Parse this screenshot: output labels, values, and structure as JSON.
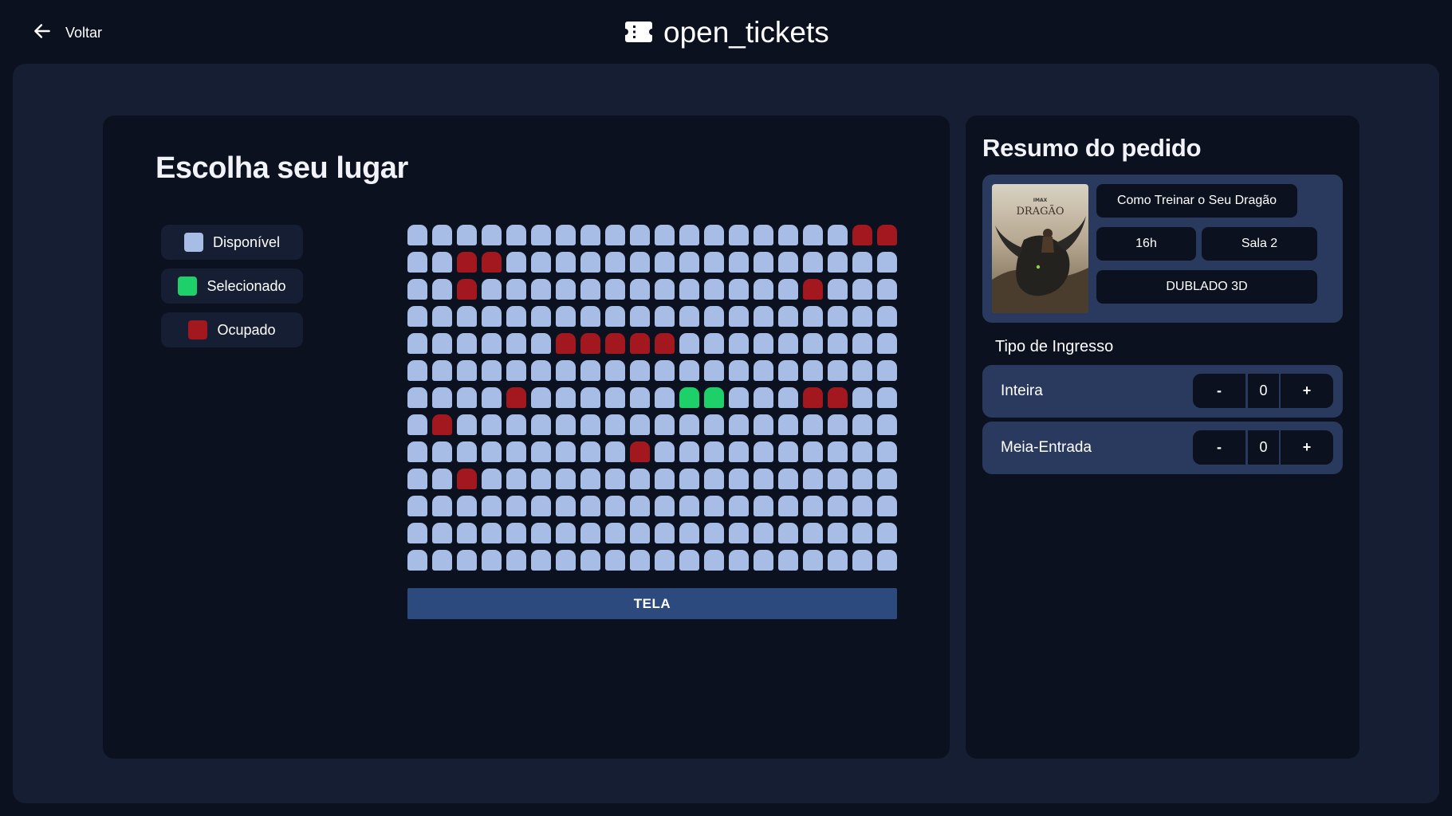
{
  "header": {
    "back_label": "Voltar",
    "brand_name": "open_tickets"
  },
  "seat_map": {
    "title": "Escolha seu lugar",
    "legend": [
      {
        "label": "Disponível",
        "color": "#a8bde6"
      },
      {
        "label": "Selecionado",
        "color": "#1ed06a"
      },
      {
        "label": "Ocupado",
        "color": "#a3181e"
      }
    ],
    "rows": [
      "AAAAAAAAAAAAAAAAAAOO",
      "AAOOAAAAAAAAAAAAAAAA",
      "AAOAAAAAAAAAAAAAOAAA",
      "AAAAAAAAAAAAAAAAAAAA",
      "AAAAAAOOOOOAAAAAAAAA",
      "AAAAAAAAAAAAAAAAAAAA",
      "AAAAOAAAAAASSAAAOOAA",
      "AOAAAAAAAAAAAAAAAAAA",
      "AAAAAAAAAOAAAAAAAAAA",
      "AAOAAAAAAAAAAAAAAAAA",
      "AAAAAAAAAAAAAAAAAAAA",
      "AAAAAAAAAAAAAAAAAAAA",
      "AAAAAAAAAAAAAAAAAAAA"
    ],
    "screen_label": "TELA"
  },
  "summary": {
    "title": "Resumo do pedido",
    "movie": {
      "title": "Como Treinar o Seu Dragão",
      "time": "16h",
      "room": "Sala 2",
      "format": "DUBLADO 3D",
      "poster_text": "DRAGÃO",
      "poster_badge": "IMAX"
    },
    "ticket_type_label": "Tipo de Ingresso",
    "tickets": [
      {
        "name": "Inteira",
        "minus": "-",
        "qty": "0",
        "plus": "+"
      },
      {
        "name": "Meia-Entrada",
        "minus": "-",
        "qty": "0",
        "plus": "+"
      }
    ]
  }
}
